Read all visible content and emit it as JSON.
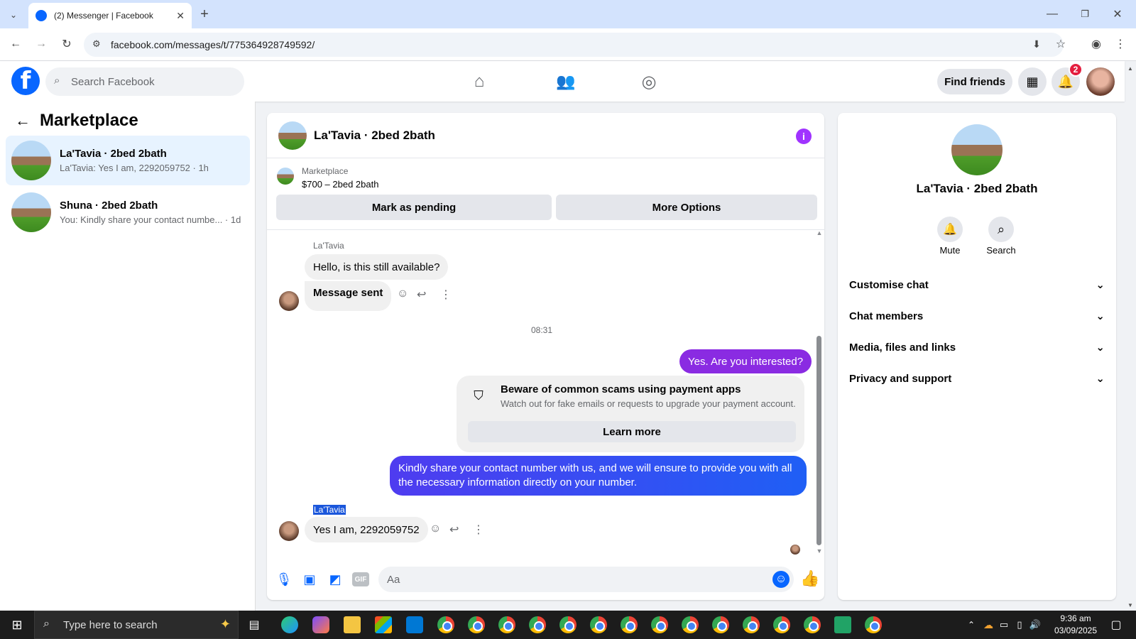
{
  "browser": {
    "tab_title": "(2) Messenger | Facebook",
    "url": "facebook.com/messages/t/775364928749592/"
  },
  "header": {
    "search_placeholder": "Search Facebook",
    "find_friends": "Find friends",
    "notification_count": "2"
  },
  "sidebar": {
    "title": "Marketplace",
    "conversations": [
      {
        "name": "La'Tavia · 2bed 2bath",
        "preview": "La'Tavia: Yes I am, 2292059752 · 1h",
        "active": true
      },
      {
        "name": "Shuna · 2bed 2bath",
        "preview": "You: Kindly share your contact numbe... · 1d",
        "active": false
      }
    ]
  },
  "chat": {
    "title": "La'Tavia · 2bed 2bath",
    "listing_source": "Marketplace",
    "listing_price": "$700 – 2bed 2bath",
    "mark_pending": "Mark as pending",
    "more_options": "More Options",
    "messages": {
      "sender1": "La'Tavia",
      "m1": "Hello, is this still available?",
      "m2": "Message sent",
      "timestamp": "08:31",
      "m3": "Yes. Are you interested?",
      "scam_title": "Beware of common scams using payment apps",
      "scam_sub": "Watch out for fake emails or requests to upgrade your payment account.",
      "learn_more": "Learn more",
      "m4": "Kindly share your contact number with us, and we will ensure to provide you with all the necessary information directly on your number.",
      "sender2": "La'Tavia",
      "m5": "Yes I am, 2292059752"
    },
    "composer_placeholder": "Aa"
  },
  "right_panel": {
    "name": "La'Tavia · 2bed 2bath",
    "mute": "Mute",
    "search": "Search",
    "sections": [
      "Customise chat",
      "Chat members",
      "Media, files and links",
      "Privacy and support"
    ]
  },
  "taskbar": {
    "search_placeholder": "Type here to search",
    "time": "9:36 am",
    "date": "03/09/2025"
  }
}
